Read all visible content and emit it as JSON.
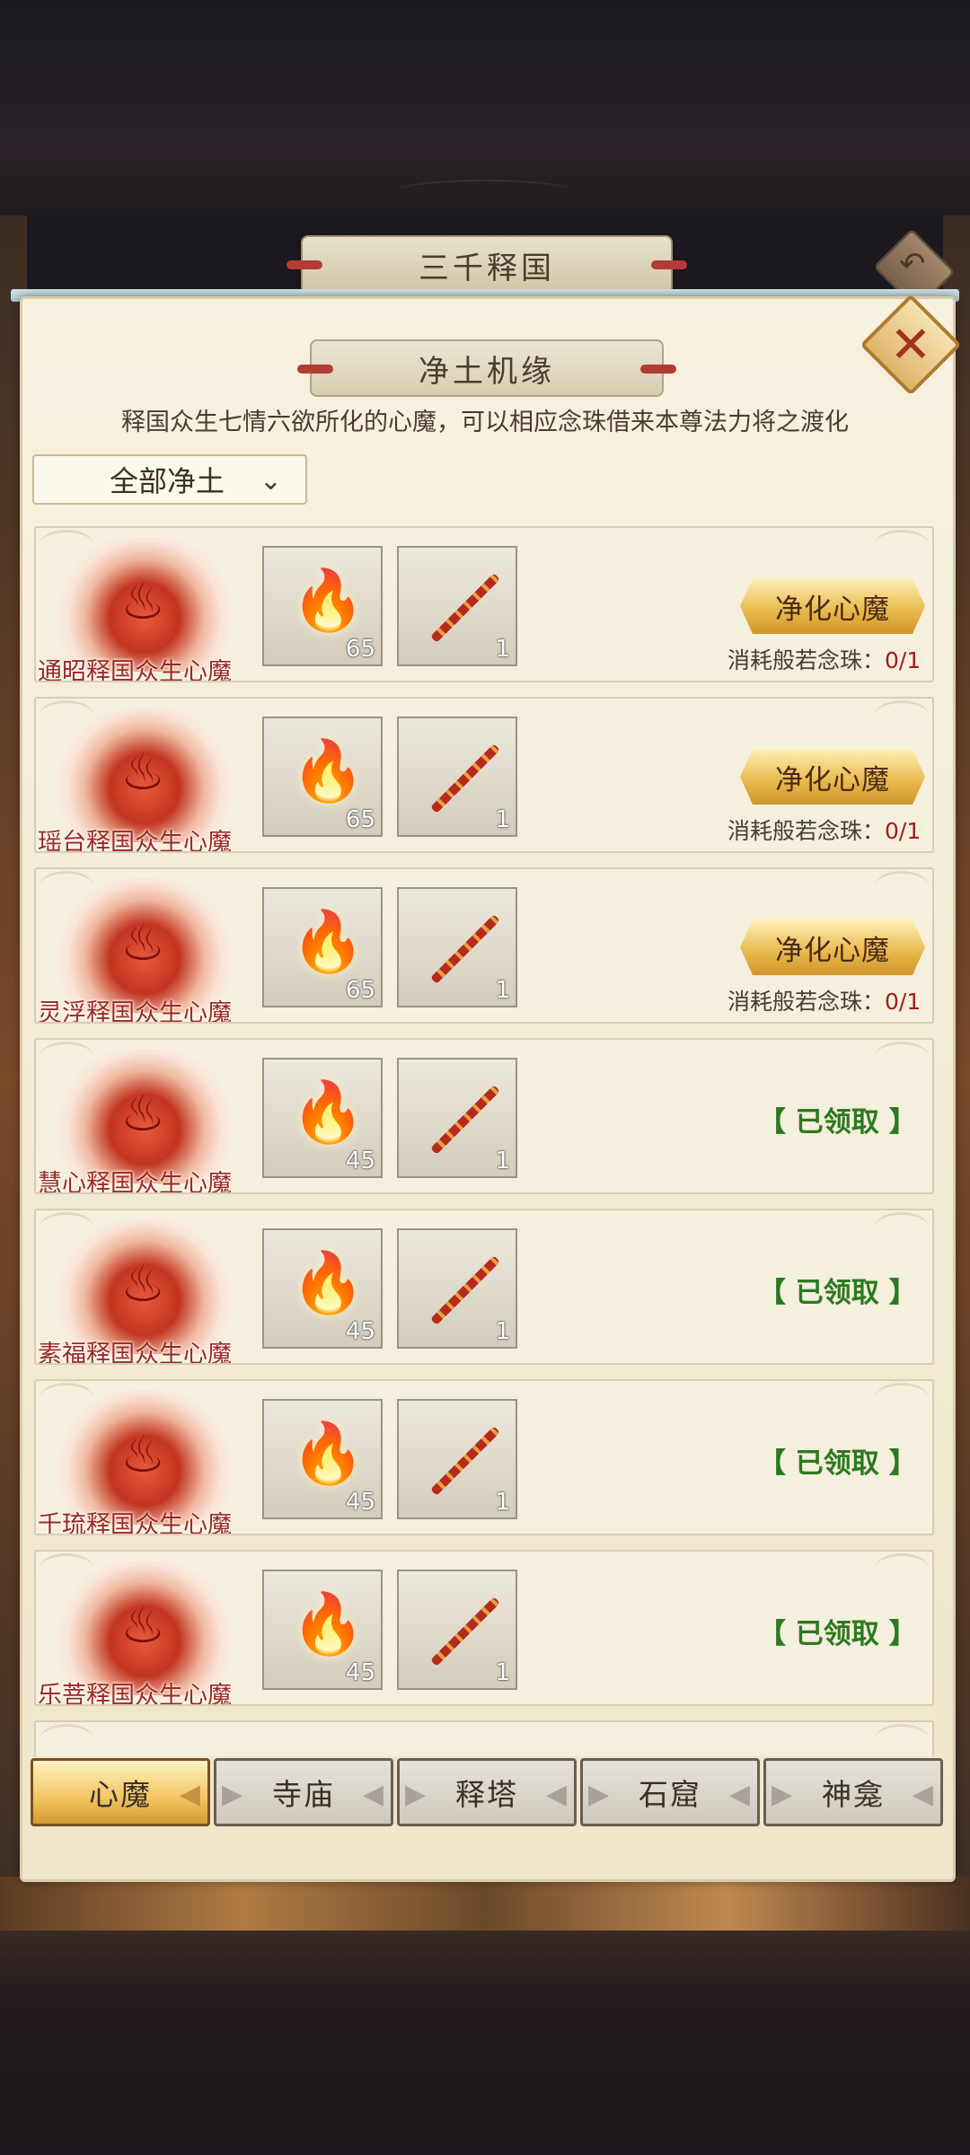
{
  "window": {
    "title": "三千释国"
  },
  "panel": {
    "title": "净土机缘",
    "description": "释国众生七情六欲所化的心魔，可以相应念珠借来本尊法力将之渡化",
    "filter_label": "全部净土"
  },
  "rows": [
    {
      "name": "通昭释国众生心魔",
      "item1_count": "65",
      "item2_count": "1",
      "button": "净化心魔",
      "cost_label": "消耗般若念珠：",
      "cost_value": "0/1"
    },
    {
      "name": "瑶台释国众生心魔",
      "item1_count": "65",
      "item2_count": "1",
      "button": "净化心魔",
      "cost_label": "消耗般若念珠：",
      "cost_value": "0/1"
    },
    {
      "name": "灵浮释国众生心魔",
      "item1_count": "65",
      "item2_count": "1",
      "button": "净化心魔",
      "cost_label": "消耗般若念珠：",
      "cost_value": "0/1"
    },
    {
      "name": "慧心释国众生心魔",
      "item1_count": "45",
      "item2_count": "1",
      "status": "【 已领取 】"
    },
    {
      "name": "素福释国众生心魔",
      "item1_count": "45",
      "item2_count": "1",
      "status": "【 已领取 】"
    },
    {
      "name": "千琉释国众生心魔",
      "item1_count": "45",
      "item2_count": "1",
      "status": "【 已领取 】"
    },
    {
      "name": "乐菩释国众生心魔",
      "item1_count": "45",
      "item2_count": "1",
      "status": "【 已领取 】"
    }
  ],
  "tabs": [
    {
      "label": "心魔",
      "active": true
    },
    {
      "label": "寺庙"
    },
    {
      "label": "释塔"
    },
    {
      "label": "石窟"
    },
    {
      "label": "神龛"
    }
  ],
  "icons": {
    "close": "close-icon",
    "back": "back-arrow-icon",
    "dropdown": "chevron-down-icon"
  },
  "colors": {
    "accent_gold": "#e8b84a",
    "claimed_green": "#2b7a1e",
    "name_red": "#9a2a22"
  }
}
